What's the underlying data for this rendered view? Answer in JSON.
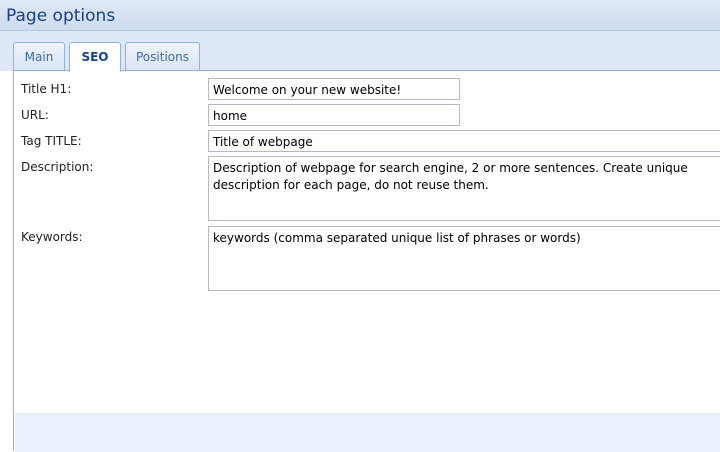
{
  "header": {
    "title": "Page options"
  },
  "tabs": [
    {
      "label": "Main",
      "active": false
    },
    {
      "label": "SEO",
      "active": true
    },
    {
      "label": "Positions",
      "active": false
    }
  ],
  "form": {
    "title_h1": {
      "label": "Title H1:",
      "value": "Welcome on your new website!"
    },
    "url": {
      "label": "URL:",
      "value": "home"
    },
    "tag_title": {
      "label": "Tag TITLE:",
      "value": "Title of webpage"
    },
    "description": {
      "label": "Description:",
      "value": "Description of webpage for search engine, 2 or more sentences. Create unique description for each page, do not reuse them."
    },
    "keywords": {
      "label": "Keywords:",
      "value": "keywords (comma separated unique list of phrases or words)"
    }
  },
  "colors": {
    "header_text": "#15428b",
    "tab_border": "#8db2e3",
    "header_bg": "#dfe8f6"
  }
}
